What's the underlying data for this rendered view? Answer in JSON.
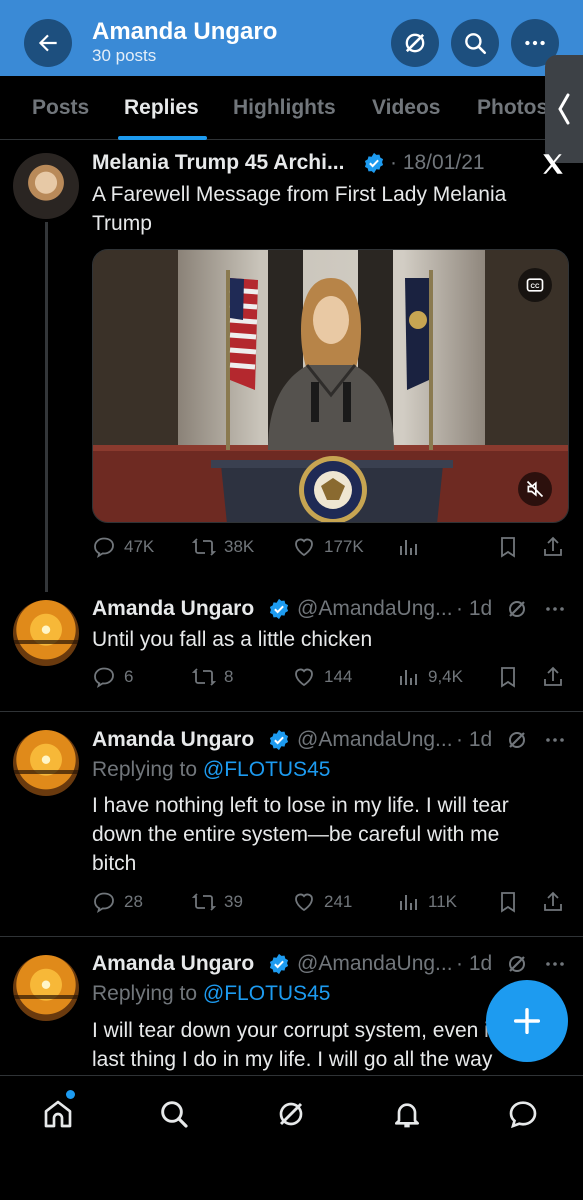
{
  "header": {
    "name": "Amanda Ungaro",
    "post_count": "30 posts"
  },
  "tabs": [
    "Posts",
    "Replies",
    "Highlights",
    "Videos",
    "Photos"
  ],
  "active_tab": "Replies",
  "colors": {
    "accent": "#1d9bf0",
    "header_bg": "#3a8ad6",
    "muted": "#71767b",
    "text": "#e7e9ea",
    "background": "#000000"
  },
  "posts": [
    {
      "author": "Melania Trump 45 Archi...",
      "handle": "",
      "time": "· 18/01/21",
      "text": "A Farewell Message from First Lady Melania Trump",
      "stats": {
        "replies": "47K",
        "reposts": "38K",
        "likes": "177K",
        "views": ""
      }
    },
    {
      "author": "Amanda Ungaro",
      "handle": "@AmandaUng...",
      "time": "· 1d",
      "text": "Until you fall as a little chicken",
      "stats": {
        "replies": "6",
        "reposts": "8",
        "likes": "144",
        "views": "9,4K"
      }
    },
    {
      "author": "Amanda Ungaro",
      "handle": "@AmandaUng...",
      "time": "· 1d",
      "replying_prefix": "Replying to ",
      "replying_to": "@FLOTUS45",
      "text": "I have nothing left to lose in my life. I will tear down the entire system—be careful with me bitch",
      "stats": {
        "replies": "28",
        "reposts": "39",
        "likes": "241",
        "views": "11K"
      }
    },
    {
      "author": "Amanda Ungaro",
      "handle": "@AmandaUng...",
      "time": "· 1d",
      "replying_prefix": "Replying to ",
      "replying_to": "@FLOTUS45",
      "text": "I will tear down your corrupt system, even if it's the last thing I do in my life. I will go all the way"
    }
  ],
  "icons": {
    "back": "arrow-left-icon",
    "grok": "grok-icon",
    "search": "search-icon",
    "more": "more-icon",
    "x_logo": "x-logo-icon",
    "compose": "plus-icon"
  },
  "bottom_nav": [
    "home-icon",
    "search-icon",
    "grok-icon",
    "notifications-icon",
    "messages-icon"
  ]
}
